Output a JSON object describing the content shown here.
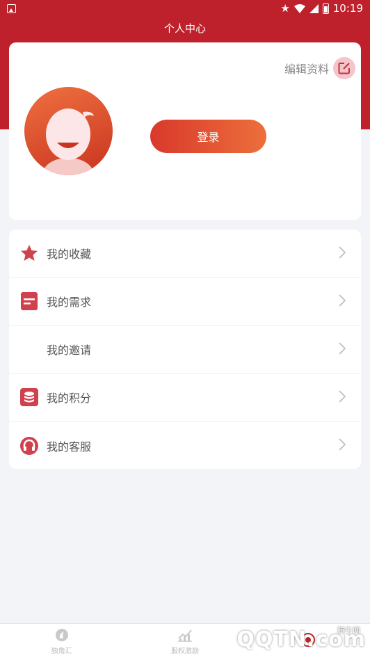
{
  "status_bar": {
    "time": "10:19",
    "icons": [
      "notification-icon",
      "star-icon",
      "wifi-icon",
      "signal-icon",
      "battery-icon"
    ]
  },
  "header": {
    "title": "个人中心"
  },
  "profile": {
    "edit_label": "编辑资料",
    "edit_icon": "edit-icon",
    "login_label": "登录"
  },
  "menu": {
    "items": [
      {
        "label": "我的收藏",
        "icon": "star-icon"
      },
      {
        "label": "我的需求",
        "icon": "list-icon"
      },
      {
        "label": "我的邀请",
        "icon": ""
      },
      {
        "label": "我的积分",
        "icon": "coins-icon"
      },
      {
        "label": "我的客服",
        "icon": "headset-icon"
      }
    ]
  },
  "tabbar": {
    "items": [
      {
        "label": "独角汇",
        "icon": "unicorn-icon"
      },
      {
        "label": "股权激励",
        "icon": "chart-icon"
      },
      {
        "label": "",
        "icon": "user-icon"
      }
    ]
  },
  "watermark": {
    "text": "QQTN.com",
    "sub": "腾牛网"
  },
  "colors": {
    "brand_red": "#bf212c",
    "accent_orange": "#ec6f3a",
    "icon_red": "#d0404d"
  }
}
